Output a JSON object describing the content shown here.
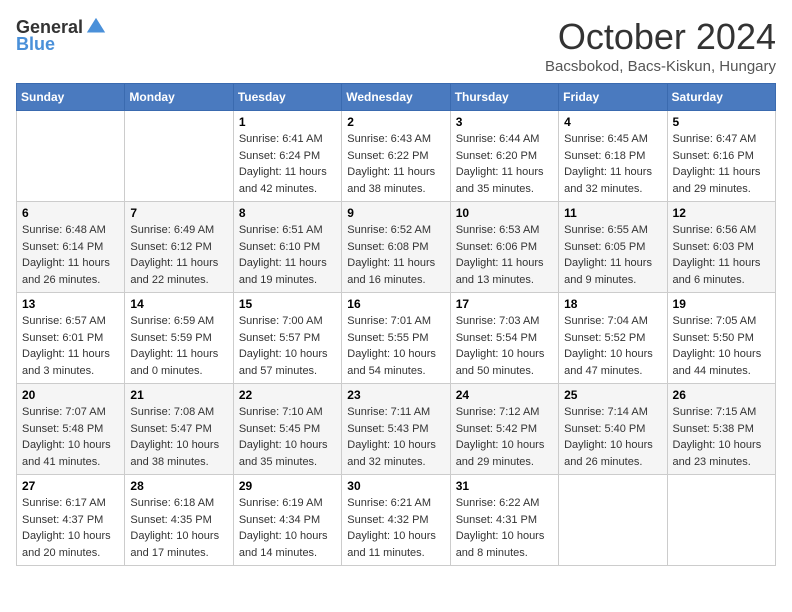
{
  "header": {
    "logo_general": "General",
    "logo_blue": "Blue",
    "title": "October 2024",
    "location": "Bacsbokod, Bacs-Kiskun, Hungary"
  },
  "days_of_week": [
    "Sunday",
    "Monday",
    "Tuesday",
    "Wednesday",
    "Thursday",
    "Friday",
    "Saturday"
  ],
  "weeks": [
    [
      {
        "day": "",
        "info": ""
      },
      {
        "day": "",
        "info": ""
      },
      {
        "day": "1",
        "sunrise": "Sunrise: 6:41 AM",
        "sunset": "Sunset: 6:24 PM",
        "daylight": "Daylight: 11 hours and 42 minutes."
      },
      {
        "day": "2",
        "sunrise": "Sunrise: 6:43 AM",
        "sunset": "Sunset: 6:22 PM",
        "daylight": "Daylight: 11 hours and 38 minutes."
      },
      {
        "day": "3",
        "sunrise": "Sunrise: 6:44 AM",
        "sunset": "Sunset: 6:20 PM",
        "daylight": "Daylight: 11 hours and 35 minutes."
      },
      {
        "day": "4",
        "sunrise": "Sunrise: 6:45 AM",
        "sunset": "Sunset: 6:18 PM",
        "daylight": "Daylight: 11 hours and 32 minutes."
      },
      {
        "day": "5",
        "sunrise": "Sunrise: 6:47 AM",
        "sunset": "Sunset: 6:16 PM",
        "daylight": "Daylight: 11 hours and 29 minutes."
      }
    ],
    [
      {
        "day": "6",
        "sunrise": "Sunrise: 6:48 AM",
        "sunset": "Sunset: 6:14 PM",
        "daylight": "Daylight: 11 hours and 26 minutes."
      },
      {
        "day": "7",
        "sunrise": "Sunrise: 6:49 AM",
        "sunset": "Sunset: 6:12 PM",
        "daylight": "Daylight: 11 hours and 22 minutes."
      },
      {
        "day": "8",
        "sunrise": "Sunrise: 6:51 AM",
        "sunset": "Sunset: 6:10 PM",
        "daylight": "Daylight: 11 hours and 19 minutes."
      },
      {
        "day": "9",
        "sunrise": "Sunrise: 6:52 AM",
        "sunset": "Sunset: 6:08 PM",
        "daylight": "Daylight: 11 hours and 16 minutes."
      },
      {
        "day": "10",
        "sunrise": "Sunrise: 6:53 AM",
        "sunset": "Sunset: 6:06 PM",
        "daylight": "Daylight: 11 hours and 13 minutes."
      },
      {
        "day": "11",
        "sunrise": "Sunrise: 6:55 AM",
        "sunset": "Sunset: 6:05 PM",
        "daylight": "Daylight: 11 hours and 9 minutes."
      },
      {
        "day": "12",
        "sunrise": "Sunrise: 6:56 AM",
        "sunset": "Sunset: 6:03 PM",
        "daylight": "Daylight: 11 hours and 6 minutes."
      }
    ],
    [
      {
        "day": "13",
        "sunrise": "Sunrise: 6:57 AM",
        "sunset": "Sunset: 6:01 PM",
        "daylight": "Daylight: 11 hours and 3 minutes."
      },
      {
        "day": "14",
        "sunrise": "Sunrise: 6:59 AM",
        "sunset": "Sunset: 5:59 PM",
        "daylight": "Daylight: 11 hours and 0 minutes."
      },
      {
        "day": "15",
        "sunrise": "Sunrise: 7:00 AM",
        "sunset": "Sunset: 5:57 PM",
        "daylight": "Daylight: 10 hours and 57 minutes."
      },
      {
        "day": "16",
        "sunrise": "Sunrise: 7:01 AM",
        "sunset": "Sunset: 5:55 PM",
        "daylight": "Daylight: 10 hours and 54 minutes."
      },
      {
        "day": "17",
        "sunrise": "Sunrise: 7:03 AM",
        "sunset": "Sunset: 5:54 PM",
        "daylight": "Daylight: 10 hours and 50 minutes."
      },
      {
        "day": "18",
        "sunrise": "Sunrise: 7:04 AM",
        "sunset": "Sunset: 5:52 PM",
        "daylight": "Daylight: 10 hours and 47 minutes."
      },
      {
        "day": "19",
        "sunrise": "Sunrise: 7:05 AM",
        "sunset": "Sunset: 5:50 PM",
        "daylight": "Daylight: 10 hours and 44 minutes."
      }
    ],
    [
      {
        "day": "20",
        "sunrise": "Sunrise: 7:07 AM",
        "sunset": "Sunset: 5:48 PM",
        "daylight": "Daylight: 10 hours and 41 minutes."
      },
      {
        "day": "21",
        "sunrise": "Sunrise: 7:08 AM",
        "sunset": "Sunset: 5:47 PM",
        "daylight": "Daylight: 10 hours and 38 minutes."
      },
      {
        "day": "22",
        "sunrise": "Sunrise: 7:10 AM",
        "sunset": "Sunset: 5:45 PM",
        "daylight": "Daylight: 10 hours and 35 minutes."
      },
      {
        "day": "23",
        "sunrise": "Sunrise: 7:11 AM",
        "sunset": "Sunset: 5:43 PM",
        "daylight": "Daylight: 10 hours and 32 minutes."
      },
      {
        "day": "24",
        "sunrise": "Sunrise: 7:12 AM",
        "sunset": "Sunset: 5:42 PM",
        "daylight": "Daylight: 10 hours and 29 minutes."
      },
      {
        "day": "25",
        "sunrise": "Sunrise: 7:14 AM",
        "sunset": "Sunset: 5:40 PM",
        "daylight": "Daylight: 10 hours and 26 minutes."
      },
      {
        "day": "26",
        "sunrise": "Sunrise: 7:15 AM",
        "sunset": "Sunset: 5:38 PM",
        "daylight": "Daylight: 10 hours and 23 minutes."
      }
    ],
    [
      {
        "day": "27",
        "sunrise": "Sunrise: 6:17 AM",
        "sunset": "Sunset: 4:37 PM",
        "daylight": "Daylight: 10 hours and 20 minutes."
      },
      {
        "day": "28",
        "sunrise": "Sunrise: 6:18 AM",
        "sunset": "Sunset: 4:35 PM",
        "daylight": "Daylight: 10 hours and 17 minutes."
      },
      {
        "day": "29",
        "sunrise": "Sunrise: 6:19 AM",
        "sunset": "Sunset: 4:34 PM",
        "daylight": "Daylight: 10 hours and 14 minutes."
      },
      {
        "day": "30",
        "sunrise": "Sunrise: 6:21 AM",
        "sunset": "Sunset: 4:32 PM",
        "daylight": "Daylight: 10 hours and 11 minutes."
      },
      {
        "day": "31",
        "sunrise": "Sunrise: 6:22 AM",
        "sunset": "Sunset: 4:31 PM",
        "daylight": "Daylight: 10 hours and 8 minutes."
      },
      {
        "day": "",
        "info": ""
      },
      {
        "day": "",
        "info": ""
      }
    ]
  ]
}
